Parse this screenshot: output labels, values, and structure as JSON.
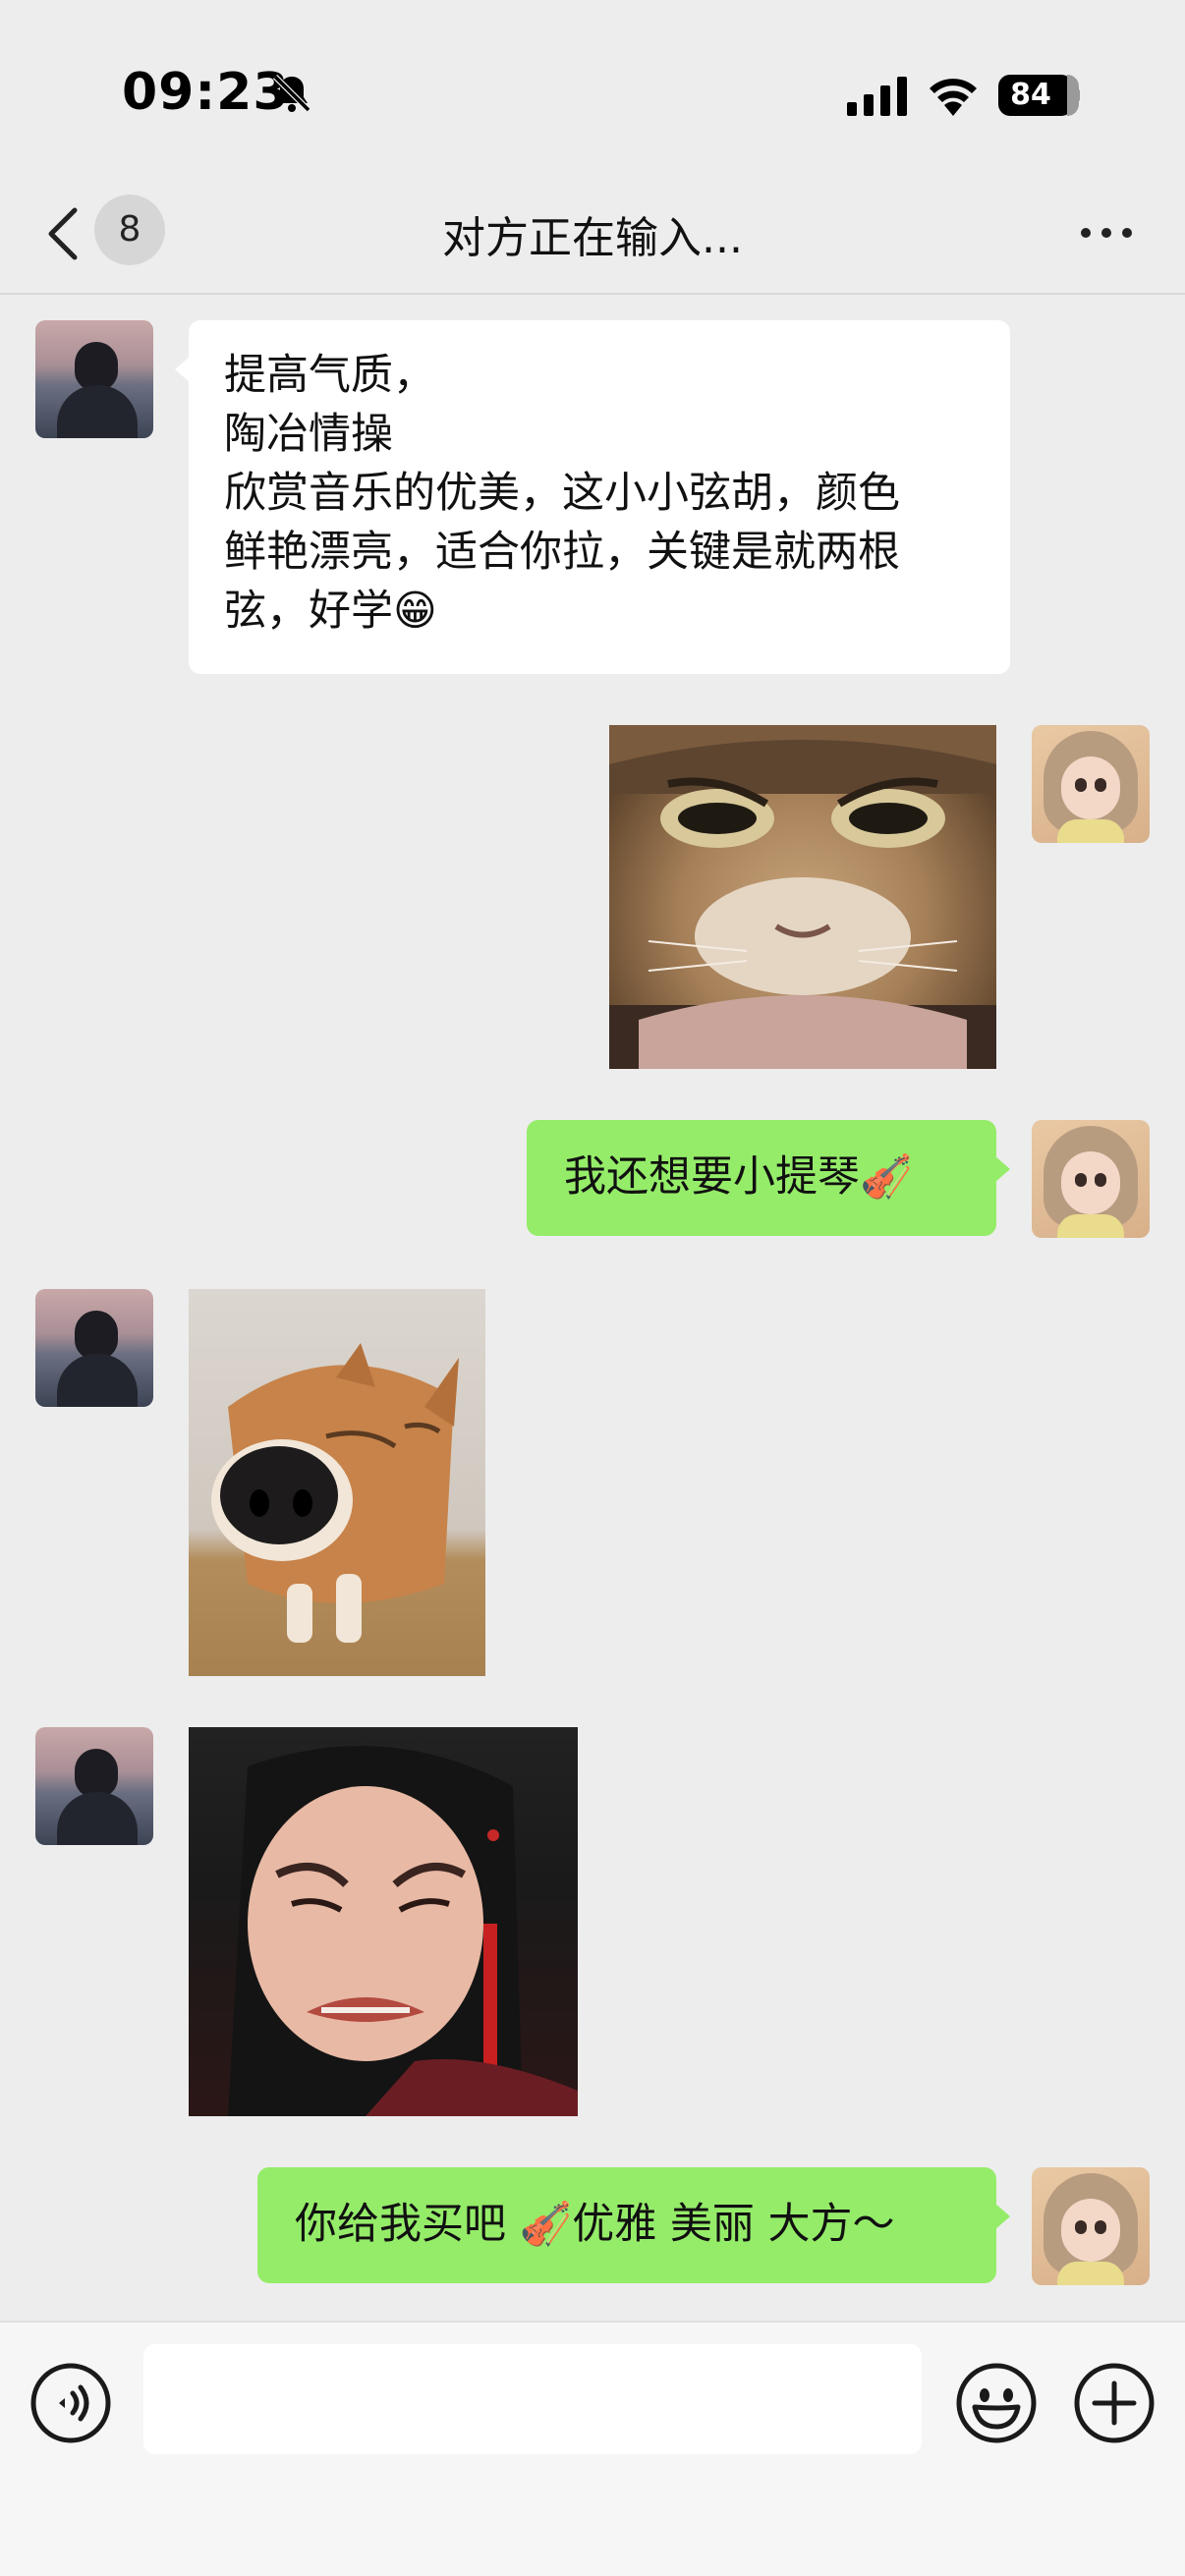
{
  "status_bar": {
    "time": "09:23",
    "battery": "84"
  },
  "nav": {
    "unread_count": "8",
    "title": "对方正在输入..."
  },
  "messages": [
    {
      "sender": "friend",
      "type": "text",
      "lines": [
        "提高气质，",
        "陶冶情操",
        "欣赏音乐的优美，这小小弦胡，颜色",
        "鲜艳漂亮，适合你拉，关键是就两根",
        "弦，好学😁"
      ]
    },
    {
      "sender": "me",
      "type": "image",
      "depicts": "cat-face-sticker"
    },
    {
      "sender": "me",
      "type": "text",
      "text": "我还想要小提琴🎻"
    },
    {
      "sender": "friend",
      "type": "image",
      "depicts": "shiba-dog-sticker"
    },
    {
      "sender": "friend",
      "type": "image",
      "depicts": "crying-woman-sticker"
    },
    {
      "sender": "me",
      "type": "text",
      "text": "你给我买吧 🎻优雅 美丽 大方～"
    }
  ],
  "input_bar": {
    "value": "",
    "icons": [
      "voice-icon",
      "emoji-icon",
      "plus-icon"
    ]
  },
  "colors": {
    "background": "#ededed",
    "outgoing_bubble": "#95ec69",
    "incoming_bubble": "#ffffff"
  }
}
